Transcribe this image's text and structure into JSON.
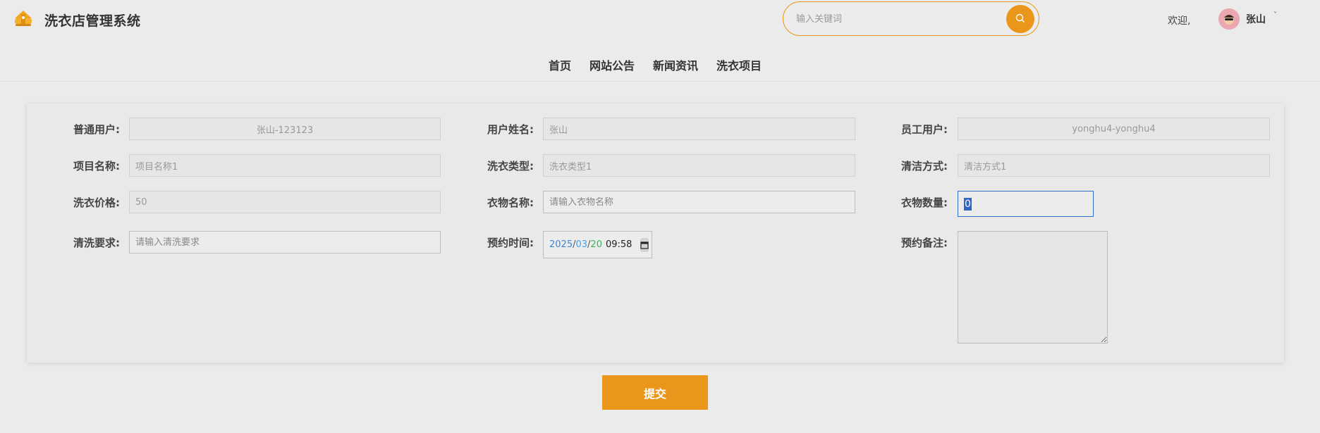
{
  "header": {
    "site_title": "洗衣店管理系统",
    "search_placeholder": "输入关键词",
    "welcome": "欢迎,",
    "user_name": "张山",
    "user_caret": "˅"
  },
  "nav": {
    "items": [
      "首页",
      "网站公告",
      "新闻资讯",
      "洗衣项目"
    ]
  },
  "form": {
    "regular_user": {
      "label": "普通用户:",
      "value": "张山-123123"
    },
    "user_name": {
      "label": "用户姓名:",
      "value": "张山"
    },
    "staff_user": {
      "label": "员工用户:",
      "value": "yonghu4-yonghu4"
    },
    "item_name": {
      "label": "项目名称:",
      "value": "项目名称1"
    },
    "laundry_type": {
      "label": "洗衣类型:",
      "value": "洗衣类型1"
    },
    "clean_method": {
      "label": "清洁方式:",
      "value": "清洁方式1"
    },
    "price": {
      "label": "洗衣价格:",
      "value": "50"
    },
    "clothes_name": {
      "label": "衣物名称:",
      "placeholder": "请输入衣物名称"
    },
    "clothes_qty": {
      "label": "衣物数量:",
      "value": "0"
    },
    "clean_req": {
      "label": "清洗要求:",
      "placeholder": "请输入清洗要求"
    },
    "booking_time": {
      "label": "预约时间:",
      "year": "2025",
      "month": "03",
      "day": "20",
      "time": "09:58",
      "sep": "/"
    },
    "booking_note": {
      "label": "预约备注:"
    }
  },
  "submit_label": "提交",
  "colors": {
    "accent": "#e9961a",
    "focus": "#2e6fc7"
  }
}
